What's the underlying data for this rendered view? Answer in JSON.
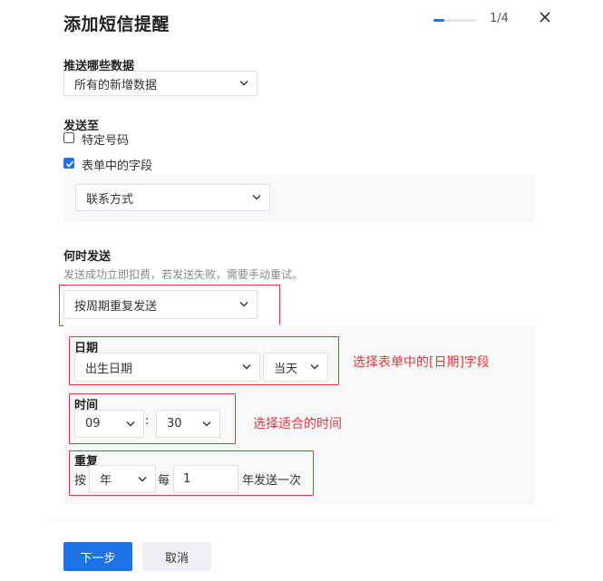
{
  "dialog": {
    "title": "添加短信提醒",
    "progress": {
      "step": 1,
      "total": 4,
      "label": "1/4"
    }
  },
  "data_section": {
    "label": "推送哪些数据",
    "selected": "所有的新增数据"
  },
  "send_to": {
    "label": "发送至",
    "option_specific": "特定号码",
    "option_form_field": "表单中的字段",
    "specific_checked": false,
    "form_field_checked": true,
    "field_selected": "联系方式"
  },
  "when": {
    "label": "何时发送",
    "hint": "发送成功立即扣费，若发送失败，需要手动重试。",
    "mode_selected": "按周期重复发送",
    "date": {
      "label": "日期",
      "field_selected": "出生日期",
      "offset_selected": "当天"
    },
    "time": {
      "label": "时间",
      "hour": "09",
      "separator": ":",
      "minute": "30"
    },
    "repeat": {
      "label": "重复",
      "prefix": "按",
      "unit_selected": "年",
      "every": "每",
      "count": "1",
      "suffix": "年发送一次"
    }
  },
  "annotations": {
    "date_note": "选择表单中的[日期]字段",
    "time_note": "选择适合的时间"
  },
  "footer": {
    "next_label": "下一步",
    "cancel_label": "取消"
  },
  "colors": {
    "primary": "#1e73e8",
    "annotation_red": "#e23b3b",
    "panel_bg": "#f7f8fa"
  }
}
